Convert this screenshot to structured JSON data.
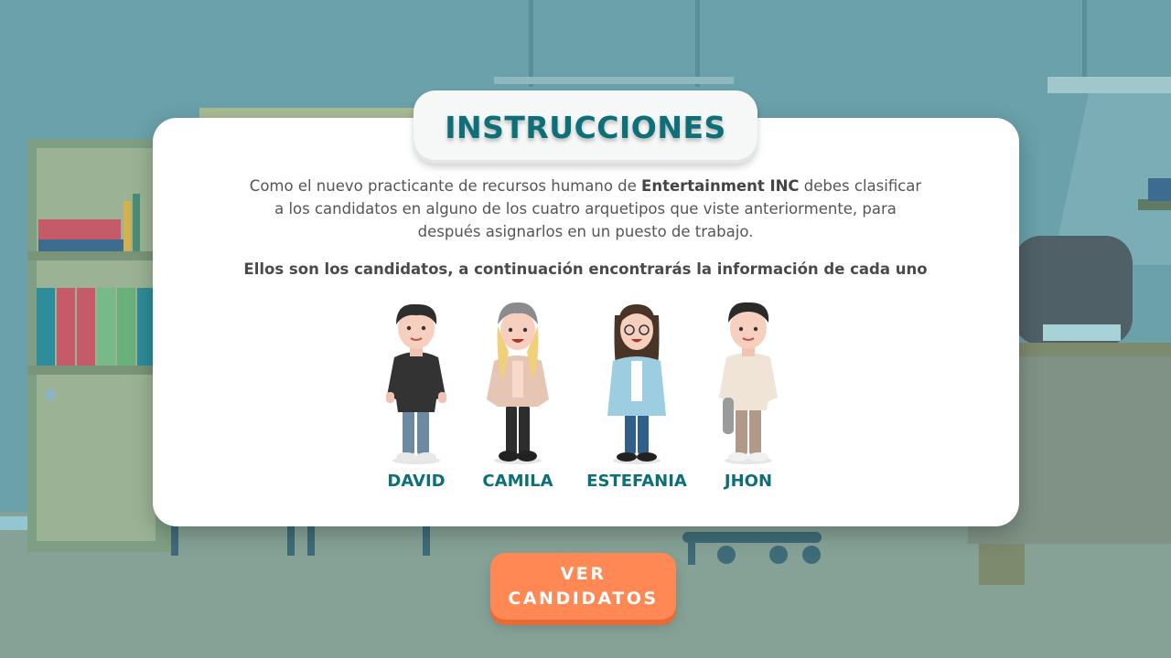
{
  "modal": {
    "title": "INSTRUCCIONES",
    "intro_before": "Como el nuevo practicante de recursos humano de ",
    "intro_company": "Entertainment INC",
    "intro_after": " debes clasificar a los candidatos en alguno de los cuatro arquetipos que viste anteriormente, para después asignarlos en un puesto de trabajo.",
    "lead": "Ellos son los candidatos, a continuación encontrarás la información de cada uno"
  },
  "candidates": [
    {
      "name": "DAVID"
    },
    {
      "name": "CAMILA"
    },
    {
      "name": "ESTEFANIA"
    },
    {
      "name": "JHON"
    }
  ],
  "button": {
    "line1": "VER",
    "line2": "CANDIDATOS"
  },
  "colors": {
    "accent": "#0d6f78",
    "button": "#ff8855",
    "background": "#6aa0aa"
  }
}
